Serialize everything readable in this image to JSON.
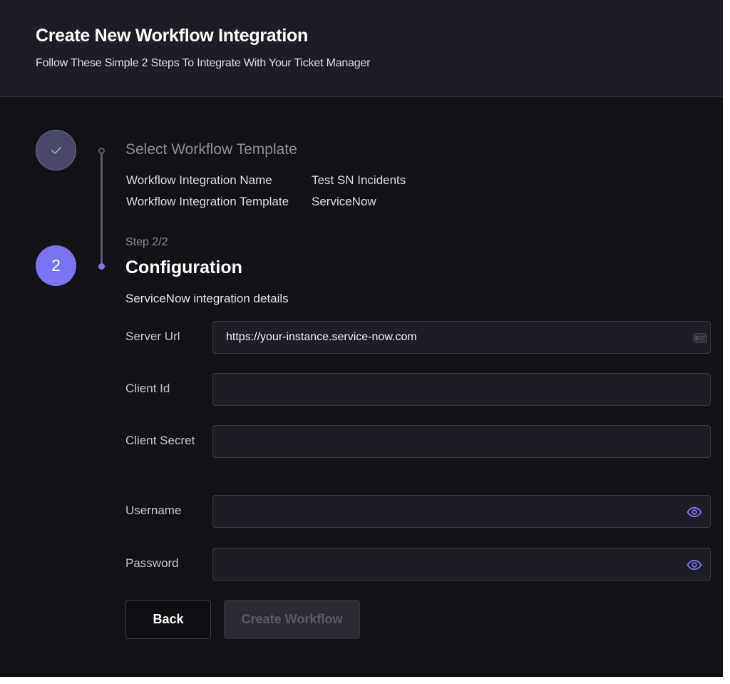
{
  "header": {
    "title": "Create New Workflow Integration",
    "subtitle": "Follow These Simple 2 Steps To Integrate With Your Ticket Manager"
  },
  "steps": {
    "step1": {
      "title": "Select Workflow Template",
      "status": "completed",
      "details": [
        {
          "label": "Workflow Integration Name",
          "value": "Test SN Incidents"
        },
        {
          "label": "Workflow Integration Template",
          "value": "ServiceNow"
        }
      ]
    },
    "step2": {
      "number": "2",
      "counter": "Step 2/2",
      "title": "Configuration",
      "section_label": "ServiceNow integration details"
    }
  },
  "form": {
    "server_url": {
      "label": "Server Url",
      "value": "https://your-instance.service-now.com",
      "icon": "contact-card-icon"
    },
    "client_id": {
      "label": "Client Id",
      "value": ""
    },
    "client_secret": {
      "label": "Client Secret",
      "value": ""
    },
    "username": {
      "label": "Username",
      "value": "",
      "icon": "eye-icon"
    },
    "password": {
      "label": "Password",
      "value": "",
      "icon": "eye-icon"
    }
  },
  "buttons": {
    "back": "Back",
    "create": "Create Workflow"
  },
  "colors": {
    "accent": "#7b74f0",
    "background": "#121217",
    "header": "#1d1e25",
    "input": "#1e1f26"
  }
}
